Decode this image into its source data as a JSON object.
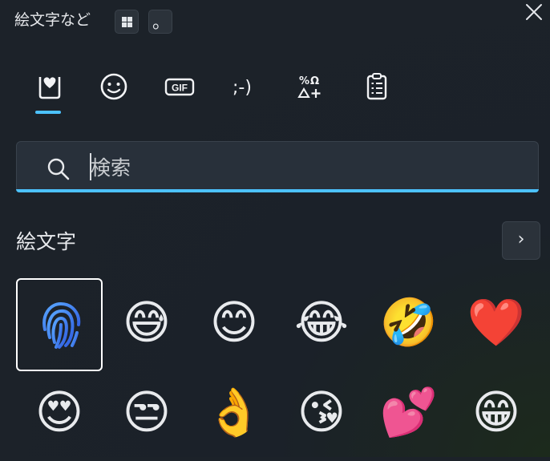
{
  "window": {
    "title": "絵文字など",
    "shortcut_key_period": "。"
  },
  "tabs": [
    {
      "label": "最近使用したもの",
      "icon": "heart-clipboard-icon"
    },
    {
      "label": "絵文字",
      "icon": "smiley-icon"
    },
    {
      "label": "GIF",
      "icon": "gif-icon"
    },
    {
      "label": "顔文字",
      "icon": "kaomoji-icon"
    },
    {
      "label": "記号",
      "icon": "symbols-icon"
    },
    {
      "label": "クリップボードの履歴",
      "icon": "clipboard-icon"
    }
  ],
  "search": {
    "placeholder": "検索",
    "value": ""
  },
  "section": {
    "title": "絵文字",
    "more": "›"
  },
  "emoji_rows": [
    [
      "fingerprint",
      "😅",
      "😊",
      "😂",
      "🤣",
      "❤️"
    ],
    [
      "😍",
      "😒",
      "👌",
      "😘",
      "💕",
      "😁"
    ]
  ],
  "colors": {
    "accent": "#4cc2ff",
    "background": "#1c2229"
  }
}
